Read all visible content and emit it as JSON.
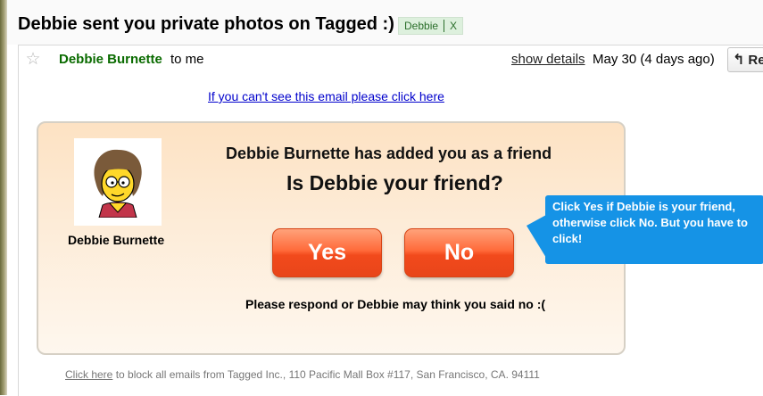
{
  "subject": "Debbie sent you private photos on Tagged :)",
  "label": {
    "text": "Debbie",
    "remove": "X"
  },
  "header": {
    "sender": "Debbie Burnette",
    "recipient": "to me",
    "show_details": "show details",
    "date": "May 30 (4 days ago)",
    "reply_label": "Re",
    "icons": {
      "star": "star-icon",
      "reply": "reply-arrow-icon"
    }
  },
  "body": {
    "cant_see_link": "If you can't see this email please click here",
    "avatar_name": "Debbie Burnette",
    "added_line": "Debbie Burnette has added you as a friend",
    "question": "Is Debbie your friend?",
    "yes_label": "Yes",
    "no_label": "No",
    "respond_line": "Please respond or Debbie may think you said no :(",
    "callout_text": "Click Yes if Debbie is your friend, otherwise click No. But you have to click!"
  },
  "footer": {
    "click_here": "Click here",
    "rest": " to block all emails from Tagged Inc., 110 Pacific Mall Box #117, San Francisco, CA. 94111"
  },
  "colors": {
    "sender_green": "#0a6b00",
    "link_blue": "#0000cc",
    "button_orange": "#f24a1c",
    "callout_blue": "#1593e6"
  }
}
